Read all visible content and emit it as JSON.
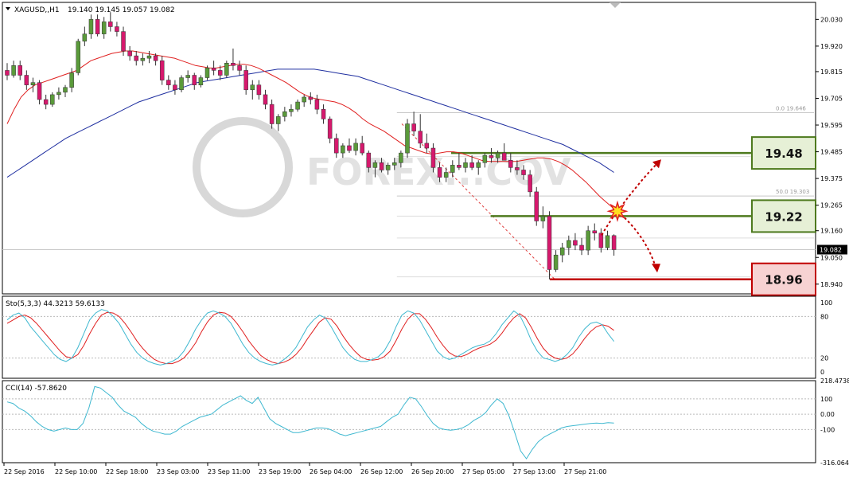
{
  "header": {
    "symbol": "XAGUSD,,H1",
    "ohlc": "19.140 19.145 19.057 19.082"
  },
  "watermark": "FOREX...COV",
  "colors": {
    "bull": "#5a9a3a",
    "bear": "#d6196d",
    "ma_fast": "#e02020",
    "ma_slow": "#1f2fa0",
    "level_green": "#4e7a1e",
    "level_red": "#c00000",
    "stoch_main": "#3fb8d0",
    "stoch_signal": "#e02020",
    "cci": "#3fb8d0"
  },
  "chart_data": [
    {
      "type": "candlestick",
      "name": "main",
      "ylim": [
        18.9,
        20.1
      ],
      "price_ticks": [
        "20.030",
        "19.920",
        "19.815",
        "19.705",
        "19.595",
        "19.485",
        "19.375",
        "19.265",
        "19.160",
        "19.050",
        "18.940"
      ],
      "current_price": "19.082",
      "x_labels": [
        "22 Sep 2016",
        "22 Sep 10:00",
        "22 Sep 18:00",
        "23 Sep 03:00",
        "23 Sep 11:00",
        "23 Sep 19:00",
        "26 Sep 04:00",
        "26 Sep 12:00",
        "26 Sep 20:00",
        "27 Sep 05:00",
        "27 Sep 13:00",
        "27 Sep 21:00"
      ],
      "candles": [
        [
          19.82,
          19.85,
          19.78,
          19.8
        ],
        [
          19.8,
          19.86,
          19.79,
          19.84
        ],
        [
          19.84,
          19.86,
          19.78,
          19.8
        ],
        [
          19.8,
          19.82,
          19.74,
          19.76
        ],
        [
          19.76,
          19.79,
          19.73,
          19.77
        ],
        [
          19.77,
          19.78,
          19.68,
          19.7
        ],
        [
          19.7,
          19.72,
          19.66,
          19.68
        ],
        [
          19.68,
          19.73,
          19.67,
          19.72
        ],
        [
          19.72,
          19.75,
          19.7,
          19.73
        ],
        [
          19.73,
          19.76,
          19.71,
          19.75
        ],
        [
          19.75,
          19.83,
          19.73,
          19.81
        ],
        [
          19.81,
          19.95,
          19.8,
          19.94
        ],
        [
          19.94,
          20.0,
          19.92,
          19.97
        ],
        [
          19.97,
          20.05,
          19.95,
          20.03
        ],
        [
          20.03,
          20.05,
          19.96,
          19.97
        ],
        [
          19.97,
          20.04,
          19.95,
          20.02
        ],
        [
          20.02,
          20.06,
          19.98,
          20.0
        ],
        [
          20.0,
          20.02,
          19.96,
          19.98
        ],
        [
          19.98,
          20.0,
          19.88,
          19.9
        ],
        [
          19.9,
          19.92,
          19.86,
          19.88
        ],
        [
          19.88,
          19.9,
          19.84,
          19.86
        ],
        [
          19.86,
          19.89,
          19.84,
          19.87
        ],
        [
          19.87,
          19.9,
          19.85,
          19.88
        ],
        [
          19.88,
          19.89,
          19.84,
          19.86
        ],
        [
          19.86,
          19.88,
          19.76,
          19.78
        ],
        [
          19.78,
          19.8,
          19.74,
          19.76
        ],
        [
          19.76,
          19.78,
          19.72,
          19.74
        ],
        [
          19.74,
          19.8,
          19.73,
          19.79
        ],
        [
          19.79,
          19.82,
          19.77,
          19.8
        ],
        [
          19.8,
          19.81,
          19.74,
          19.76
        ],
        [
          19.76,
          19.8,
          19.75,
          19.79
        ],
        [
          19.79,
          19.84,
          19.78,
          19.83
        ],
        [
          19.83,
          19.86,
          19.8,
          19.82
        ],
        [
          19.82,
          19.84,
          19.78,
          19.8
        ],
        [
          19.8,
          19.86,
          19.79,
          19.85
        ],
        [
          19.85,
          19.91,
          19.82,
          19.84
        ],
        [
          19.84,
          19.86,
          19.8,
          19.82
        ],
        [
          19.82,
          19.84,
          19.72,
          19.74
        ],
        [
          19.74,
          19.78,
          19.7,
          19.76
        ],
        [
          19.76,
          19.78,
          19.7,
          19.72
        ],
        [
          19.72,
          19.74,
          19.66,
          19.68
        ],
        [
          19.68,
          19.7,
          19.58,
          19.6
        ],
        [
          19.6,
          19.64,
          19.57,
          19.63
        ],
        [
          19.63,
          19.67,
          19.61,
          19.65
        ],
        [
          19.65,
          19.68,
          19.63,
          19.66
        ],
        [
          19.66,
          19.7,
          19.65,
          19.69
        ],
        [
          19.69,
          19.72,
          19.67,
          19.71
        ],
        [
          19.71,
          19.73,
          19.68,
          19.7
        ],
        [
          19.7,
          19.72,
          19.64,
          19.66
        ],
        [
          19.66,
          19.68,
          19.6,
          19.62
        ],
        [
          19.62,
          19.63,
          19.52,
          19.54
        ],
        [
          19.54,
          19.56,
          19.46,
          19.48
        ],
        [
          19.48,
          19.52,
          19.46,
          19.51
        ],
        [
          19.51,
          19.54,
          19.48,
          19.49
        ],
        [
          19.49,
          19.54,
          19.47,
          19.52
        ],
        [
          19.52,
          19.55,
          19.47,
          19.48
        ],
        [
          19.48,
          19.49,
          19.4,
          19.42
        ],
        [
          19.42,
          19.45,
          19.38,
          19.44
        ],
        [
          19.44,
          19.46,
          19.4,
          19.41
        ],
        [
          19.41,
          19.44,
          19.39,
          19.43
        ],
        [
          19.43,
          19.46,
          19.41,
          19.44
        ],
        [
          19.44,
          19.49,
          19.42,
          19.48
        ],
        [
          19.48,
          19.62,
          19.46,
          19.6
        ],
        [
          19.6,
          19.65,
          19.55,
          19.57
        ],
        [
          19.57,
          19.64,
          19.5,
          19.52
        ],
        [
          19.52,
          19.56,
          19.48,
          19.5
        ],
        [
          19.5,
          19.52,
          19.4,
          19.42
        ],
        [
          19.42,
          19.44,
          19.36,
          19.38
        ],
        [
          19.38,
          19.42,
          19.36,
          19.4
        ],
        [
          19.4,
          19.45,
          19.38,
          19.43
        ],
        [
          19.43,
          19.48,
          19.41,
          19.42
        ],
        [
          19.42,
          19.46,
          19.4,
          19.44
        ],
        [
          19.44,
          19.47,
          19.41,
          19.42
        ],
        [
          19.42,
          19.45,
          19.39,
          19.44
        ],
        [
          19.44,
          19.48,
          19.42,
          19.47
        ],
        [
          19.47,
          19.5,
          19.44,
          19.46
        ],
        [
          19.46,
          19.49,
          19.44,
          19.48
        ],
        [
          19.48,
          19.52,
          19.46,
          19.45
        ],
        [
          19.45,
          19.48,
          19.4,
          19.42
        ],
        [
          19.42,
          19.45,
          19.39,
          19.41
        ],
        [
          19.41,
          19.43,
          19.37,
          19.39
        ],
        [
          19.39,
          19.41,
          19.3,
          19.32
        ],
        [
          19.32,
          19.34,
          19.18,
          19.2
        ],
        [
          19.2,
          19.26,
          19.17,
          19.22
        ],
        [
          19.22,
          19.24,
          18.96,
          19.0
        ],
        [
          19.0,
          19.08,
          18.99,
          19.06
        ],
        [
          19.06,
          19.11,
          19.03,
          19.09
        ],
        [
          19.09,
          19.14,
          19.06,
          19.12
        ],
        [
          19.12,
          19.15,
          19.08,
          19.1
        ],
        [
          19.1,
          19.13,
          19.06,
          19.08
        ],
        [
          19.08,
          19.18,
          19.06,
          19.16
        ],
        [
          19.16,
          19.19,
          19.12,
          19.15
        ],
        [
          19.15,
          19.17,
          19.07,
          19.09
        ],
        [
          19.09,
          19.16,
          19.08,
          19.14
        ],
        [
          19.14,
          19.145,
          19.057,
          19.082
        ]
      ],
      "ma_fast": [
        19.6,
        19.66,
        19.71,
        19.74,
        19.76,
        19.77,
        19.78,
        19.79,
        19.8,
        19.81,
        19.82,
        19.84,
        19.86,
        19.87,
        19.88,
        19.89,
        19.895,
        19.9,
        19.9,
        19.895,
        19.89,
        19.885,
        19.88,
        19.875,
        19.87,
        19.86,
        19.85,
        19.84,
        19.835,
        19.83,
        19.83,
        19.835,
        19.84,
        19.845,
        19.845,
        19.84,
        19.83,
        19.815,
        19.8,
        19.785,
        19.77,
        19.75,
        19.73,
        19.715,
        19.705,
        19.7,
        19.695,
        19.69,
        19.68,
        19.665,
        19.645,
        19.62,
        19.6,
        19.585,
        19.57,
        19.55,
        19.53,
        19.51,
        19.5,
        19.49,
        19.48,
        19.475,
        19.48,
        19.485,
        19.485,
        19.48,
        19.47,
        19.46,
        19.45,
        19.445,
        19.445,
        19.445,
        19.445,
        19.445,
        19.45,
        19.455,
        19.46,
        19.46,
        19.455,
        19.445,
        19.43,
        19.41,
        19.385,
        19.36,
        19.33,
        19.3,
        19.275,
        19.25
      ],
      "ma_slow": [
        19.38,
        19.4,
        19.42,
        19.44,
        19.46,
        19.48,
        19.5,
        19.52,
        19.54,
        19.555,
        19.57,
        19.585,
        19.6,
        19.615,
        19.63,
        19.645,
        19.66,
        19.675,
        19.69,
        19.7,
        19.71,
        19.72,
        19.73,
        19.74,
        19.75,
        19.76,
        19.77,
        19.775,
        19.78,
        19.785,
        19.79,
        19.795,
        19.8,
        19.805,
        19.81,
        19.815,
        19.82,
        19.825,
        19.825,
        19.825,
        19.825,
        19.825,
        19.825,
        19.82,
        19.815,
        19.81,
        19.805,
        19.8,
        19.795,
        19.785,
        19.775,
        19.765,
        19.755,
        19.745,
        19.735,
        19.725,
        19.715,
        19.705,
        19.695,
        19.685,
        19.675,
        19.665,
        19.655,
        19.645,
        19.635,
        19.625,
        19.615,
        19.605,
        19.595,
        19.585,
        19.575,
        19.565,
        19.555,
        19.545,
        19.535,
        19.525,
        19.515,
        19.5,
        19.485,
        19.47,
        19.455,
        19.44,
        19.42,
        19.4
      ],
      "fib_labels": [
        "0.0 19.646",
        "50.0 19.303"
      ],
      "levels": [
        {
          "label": "19.48",
          "value": 19.48,
          "kind": "resistance"
        },
        {
          "label": "19.22",
          "value": 19.22,
          "kind": "pivot"
        },
        {
          "label": "18.96",
          "value": 18.96,
          "kind": "support"
        }
      ]
    },
    {
      "type": "line",
      "name": "stochastic",
      "title": "Sto(5,3,3) 44.3213 59.6133",
      "ylim": [
        0,
        100
      ],
      "ticks": [
        "100",
        "80",
        "20",
        "0"
      ],
      "main": [
        75,
        82,
        85,
        78,
        65,
        55,
        45,
        35,
        25,
        18,
        15,
        20,
        35,
        55,
        75,
        85,
        90,
        88,
        80,
        70,
        55,
        40,
        28,
        20,
        15,
        12,
        10,
        12,
        15,
        20,
        30,
        45,
        62,
        75,
        85,
        88,
        85,
        80,
        70,
        55,
        40,
        28,
        20,
        15,
        12,
        10,
        12,
        18,
        25,
        35,
        50,
        65,
        75,
        82,
        78,
        65,
        50,
        35,
        25,
        18,
        15,
        15,
        18,
        22,
        30,
        45,
        65,
        82,
        88,
        85,
        75,
        60,
        45,
        30,
        22,
        18,
        20,
        25,
        30,
        35,
        38,
        40,
        45,
        55,
        68,
        78,
        88,
        82,
        65,
        45,
        30,
        20,
        18,
        15,
        18,
        25,
        35,
        50,
        62,
        70,
        72,
        68,
        55,
        44
      ],
      "signal": [
        70,
        75,
        80,
        82,
        78,
        70,
        60,
        50,
        40,
        30,
        22,
        20,
        25,
        38,
        55,
        70,
        82,
        86,
        85,
        80,
        70,
        58,
        45,
        34,
        25,
        18,
        14,
        12,
        12,
        15,
        20,
        30,
        42,
        58,
        72,
        82,
        86,
        85,
        80,
        70,
        58,
        45,
        34,
        24,
        18,
        14,
        12,
        14,
        18,
        25,
        35,
        48,
        60,
        72,
        78,
        76,
        66,
        52,
        40,
        30,
        22,
        18,
        17,
        18,
        22,
        30,
        45,
        62,
        76,
        84,
        84,
        76,
        64,
        50,
        38,
        28,
        23,
        22,
        25,
        30,
        34,
        37,
        40,
        46,
        56,
        68,
        78,
        84,
        78,
        64,
        48,
        34,
        25,
        20,
        18,
        20,
        26,
        36,
        48,
        58,
        65,
        68,
        66,
        60
      ]
    },
    {
      "type": "line",
      "name": "cci",
      "title": "CCI(14) -57.8620",
      "ylim": [
        -316.064,
        218.4738
      ],
      "ticks": [
        "218.4738",
        "100",
        "0.00",
        "-100",
        "-316.064"
      ],
      "values": [
        80,
        70,
        40,
        20,
        -10,
        -50,
        -80,
        -100,
        -110,
        -100,
        -90,
        -100,
        -100,
        -60,
        40,
        180,
        170,
        140,
        110,
        60,
        20,
        0,
        -20,
        -60,
        -90,
        -110,
        -120,
        -130,
        -130,
        -110,
        -80,
        -60,
        -40,
        -20,
        -10,
        0,
        30,
        60,
        80,
        100,
        120,
        90,
        70,
        110,
        40,
        -30,
        -60,
        -80,
        -100,
        -120,
        -120,
        -110,
        -100,
        -90,
        -90,
        -95,
        -110,
        -130,
        -140,
        -130,
        -120,
        -110,
        -100,
        -90,
        -80,
        -50,
        -20,
        0,
        60,
        110,
        100,
        50,
        -10,
        -60,
        -90,
        -100,
        -105,
        -100,
        -90,
        -70,
        -40,
        -20,
        10,
        60,
        100,
        70,
        -10,
        -120,
        -240,
        -290,
        -230,
        -180,
        -150,
        -130,
        -110,
        -90,
        -80,
        -75,
        -70,
        -65,
        -60,
        -58,
        -60,
        -55,
        -58
      ]
    }
  ]
}
